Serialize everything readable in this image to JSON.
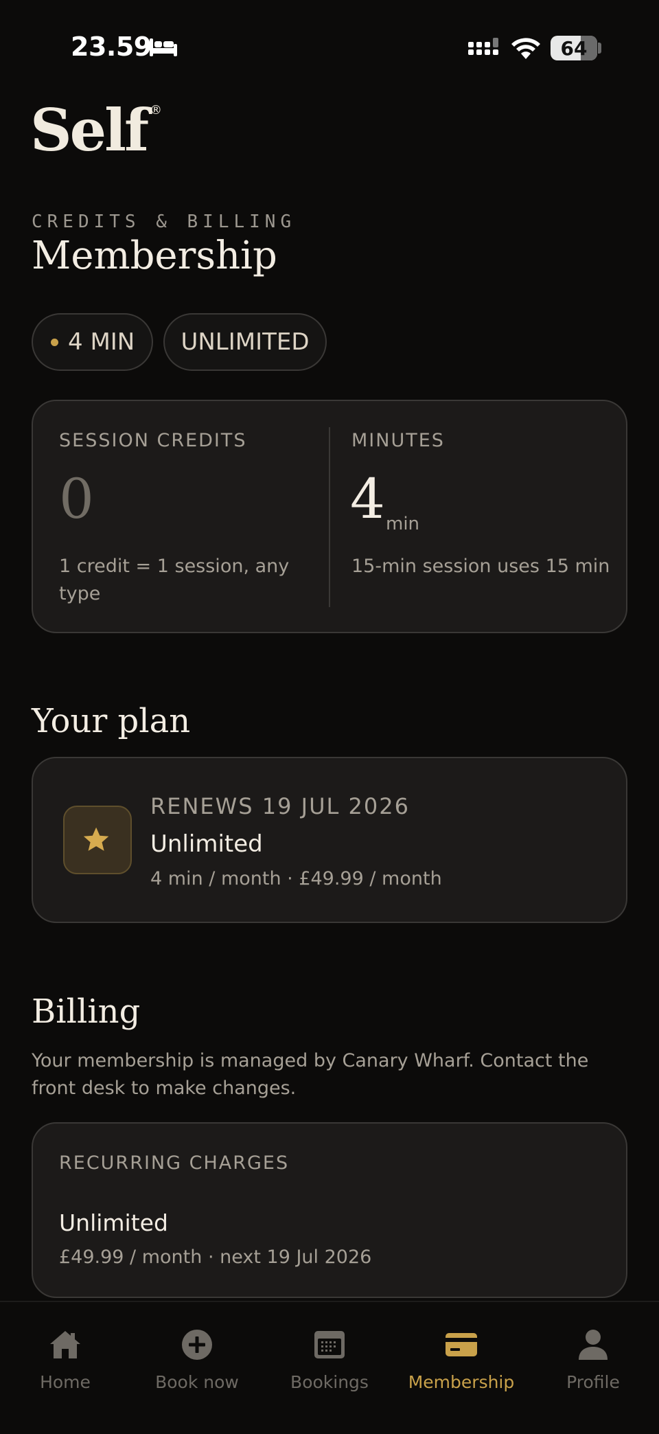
{
  "status_bar": {
    "time": "23.59",
    "battery": "64"
  },
  "brand": {
    "logo": "Self",
    "registered": "®"
  },
  "header": {
    "eyebrow": "CREDITS & BILLING",
    "title": "Membership"
  },
  "chips": [
    {
      "label": "4 MIN"
    },
    {
      "label": "UNLIMITED"
    }
  ],
  "credits": {
    "session_label": "SESSION CREDITS",
    "session_value": "0",
    "session_note_line1": "1 credit = 1 session, any",
    "session_note_line2": "type",
    "minutes_label": "MINUTES",
    "minutes_value": "4",
    "minutes_unit": "min",
    "minutes_note": "15-min session uses 15 min"
  },
  "plan": {
    "section_title": "Your plan",
    "renews": "RENEWS 19 JUL 2026",
    "name": "Unlimited",
    "detail": "4 min / month · £49.99 / month"
  },
  "billing": {
    "section_title": "Billing",
    "text": "Your membership is managed by Canary Wharf. Contact the front desk to make changes.",
    "recurring_label": "RECURRING CHARGES",
    "charge_name": "Unlimited",
    "charge_detail": "£49.99 / month · next 19 Jul 2026"
  },
  "nav": {
    "items": [
      {
        "label": "Home",
        "icon": "home-icon"
      },
      {
        "label": "Book now",
        "icon": "plus-circle-icon"
      },
      {
        "label": "Bookings",
        "icon": "calendar-icon"
      },
      {
        "label": "Membership",
        "icon": "card-icon",
        "active": true
      },
      {
        "label": "Profile",
        "icon": "person-icon"
      }
    ]
  },
  "colors": {
    "accent": "#c9a14a",
    "background": "#0c0b0a",
    "card": "#1c1a19"
  }
}
